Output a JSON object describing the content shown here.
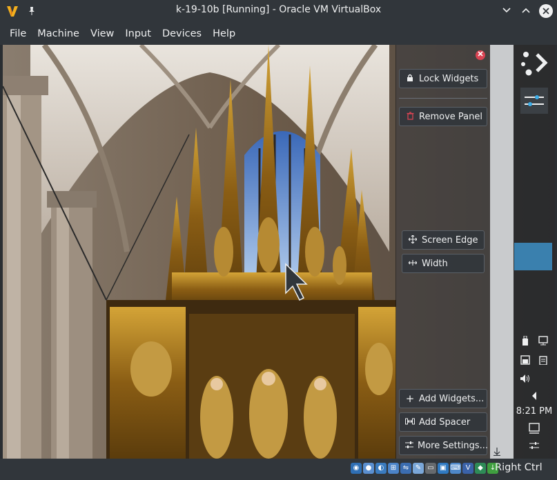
{
  "window": {
    "title": "k-19-10b [Running] - Oracle VM VirtualBox",
    "minimize_icon": "chevron-down-icon",
    "maximize_icon": "chevron-up-icon",
    "close_icon": "close-icon"
  },
  "menu": {
    "items": [
      "File",
      "Machine",
      "View",
      "Input",
      "Devices",
      "Help"
    ]
  },
  "panel_config": {
    "lock_widgets": "Lock Widgets",
    "remove_panel": "Remove Panel",
    "screen_edge": "Screen Edge",
    "width": "Width",
    "add_widgets": "Add Widgets...",
    "add_spacer": "Add Spacer",
    "more_settings": "More Settings...",
    "close_color": "#da4453"
  },
  "plasma_panel": {
    "clock": "8:21 PM",
    "accent": "#3d8fc6"
  },
  "statusbar": {
    "host_key": "Right Ctrl"
  }
}
